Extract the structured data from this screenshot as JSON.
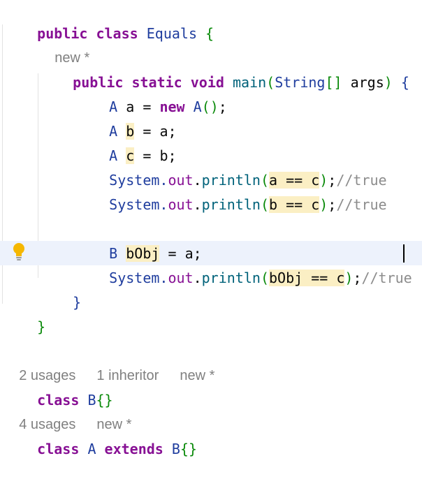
{
  "editor": {
    "line1": {
      "kw1": "public",
      "kw2": "class",
      "name": "Equals",
      "brace": "{"
    },
    "hint1": {
      "text": "new *"
    },
    "line2": {
      "kw1": "public",
      "kw2": "static",
      "kw3": "void",
      "method": "main",
      "lp": "(",
      "type": "String",
      "arr": "[]",
      "arg": "args",
      "rp": ")",
      "brace": "{"
    },
    "line3": {
      "type": "A",
      "var": "a",
      "eq": "=",
      "kw": "new",
      "ctor": "A",
      "paren": "()",
      "semi": ";"
    },
    "line4": {
      "type": "A",
      "var": "b",
      "rest": "= a;"
    },
    "line5": {
      "type": "A",
      "var": "c",
      "rest": "= b;"
    },
    "line6": {
      "sys": "System.",
      "out": "out",
      "dot": ".",
      "println": "println",
      "lp": "(",
      "expr": "a == c",
      "rp": ")",
      "semi": ";",
      "comment": "//true"
    },
    "line7": {
      "sys": "System.",
      "out": "out",
      "dot": ".",
      "println": "println",
      "lp": "(",
      "expr": "b == c",
      "rp": ")",
      "semi": ";",
      "comment": "//true"
    },
    "line9": {
      "type": "B",
      "var": "bObj",
      "rest": "= a;"
    },
    "line10": {
      "sys": "System.",
      "out": "out",
      "dot": ".",
      "println": "println",
      "lp": "(",
      "expr": "bObj == c",
      "rp": ")",
      "semi": ";",
      "comment": "//true"
    },
    "line11": {
      "brace": "}"
    },
    "line12": {
      "brace": "}"
    },
    "hint2": {
      "usages": "2 usages",
      "inheritor": "1 inheritor",
      "new": "new *"
    },
    "line13": {
      "kw": "class",
      "name": "B",
      "braces": "{}"
    },
    "hint3": {
      "usages": "4 usages",
      "new": "new *"
    },
    "line14": {
      "kw1": "class",
      "name": "A",
      "kw2": "extends",
      "super": "B",
      "braces": "{}"
    }
  },
  "colors": {
    "keyword": "#871094",
    "type": "#1f3d9e",
    "method": "#00627a",
    "comment": "#8c8c8c",
    "highlight": "#fbefc4",
    "current_line": "#edf2fc",
    "bulb": "#f5b700"
  },
  "icons": {
    "gutter": "lightbulb-icon"
  }
}
